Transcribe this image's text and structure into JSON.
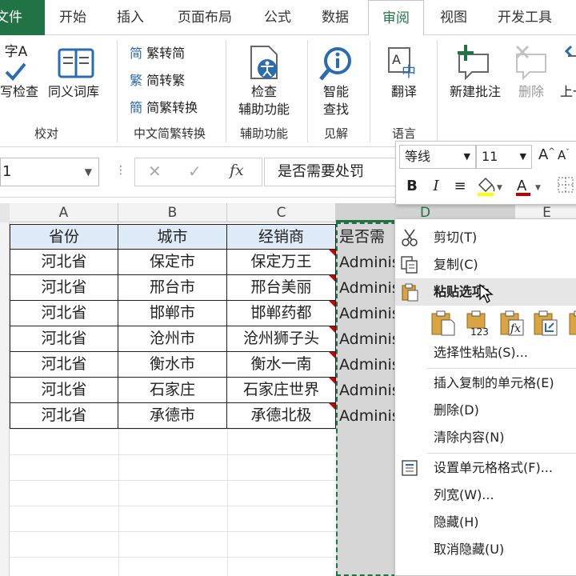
{
  "ribbon_tabs": [
    "文件",
    "开始",
    "插入",
    "页面布局",
    "公式",
    "数据",
    "审阅",
    "视图",
    "开发工具"
  ],
  "ribbon": {
    "proofing": {
      "spell_top": "字A",
      "spell": "写检查",
      "thesaurus": "同义词库",
      "group": "校对"
    },
    "chinese": {
      "to_simplified": "繁转简",
      "to_traditional": "简转繁",
      "convert": "简繁转换",
      "group": "中文简繁转换"
    },
    "accessibility": {
      "button_l1": "检查",
      "button_l2": "辅助功能",
      "group": "辅助功能"
    },
    "insights": {
      "button_l1": "智能",
      "button_l2": "查找",
      "group": "见解"
    },
    "language": {
      "button": "翻译",
      "group": "语言"
    },
    "comments": {
      "new": "新建批注",
      "delete": "删除",
      "prev": "上一"
    }
  },
  "formula_bar": {
    "name_box": "1",
    "formula": "是否需要处罚"
  },
  "columns": [
    "A",
    "B",
    "C",
    "D",
    "E"
  ],
  "table": {
    "headers": [
      "省份",
      "城市",
      "经销商",
      "是否需"
    ],
    "rows": [
      [
        "河北省",
        "保定市",
        "保定万王",
        "Adminis"
      ],
      [
        "河北省",
        "邢台市",
        "邢台美丽",
        "Adminis"
      ],
      [
        "河北省",
        "邯郸市",
        "邯郸药都",
        "Adminis"
      ],
      [
        "河北省",
        "沧州市",
        "沧州狮子头",
        "Adminis"
      ],
      [
        "河北省",
        "衡水市",
        "衡水一南",
        "Adminis"
      ],
      [
        "河北省",
        "石家庄",
        "石家庄世界",
        "Adminis"
      ],
      [
        "河北省",
        "承德市",
        "承德北极",
        "Adminis"
      ]
    ]
  },
  "mini_toolbar": {
    "font": "等线",
    "size": "11"
  },
  "context_menu": {
    "cut": "剪切(T)",
    "copy": "复制(C)",
    "paste_options": "粘贴选项:",
    "paste_special": "选择性粘贴(S)...",
    "insert_copied": "插入复制的单元格(E)",
    "delete": "删除(D)",
    "clear": "清除内容(N)",
    "format_cells": "设置单元格格式(F)...",
    "col_width": "列宽(W)...",
    "hide": "隐藏(H)",
    "unhide": "取消隐藏(U)"
  },
  "colors": {
    "excel_green": "#217346",
    "header_fill": "#deebf7",
    "comment_red": "#cc0000"
  }
}
